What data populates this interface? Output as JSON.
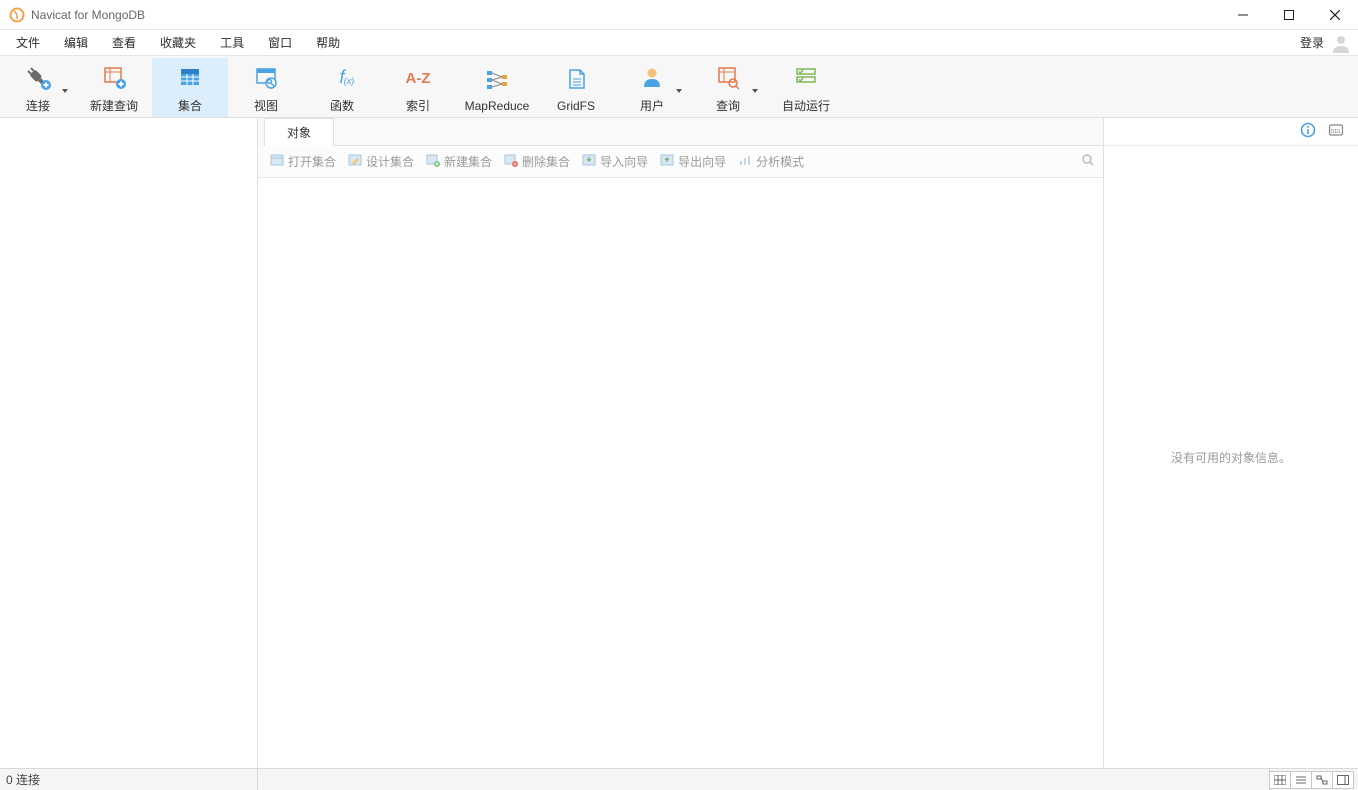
{
  "title": "Navicat for MongoDB",
  "menubar": {
    "items": [
      "文件",
      "编辑",
      "查看",
      "收藏夹",
      "工具",
      "窗口",
      "帮助"
    ],
    "login": "登录"
  },
  "toolbar": {
    "connect": {
      "label": "连接",
      "icon": "plug-icon",
      "has_dropdown": true
    },
    "newquery": {
      "label": "新建查询",
      "icon": "query-icon"
    },
    "collection": {
      "label": "集合",
      "icon": "collection-icon",
      "active": true
    },
    "view": {
      "label": "视图",
      "icon": "view-icon"
    },
    "function": {
      "label": "函数",
      "icon": "function-icon"
    },
    "index": {
      "label": "索引",
      "icon": "index-icon"
    },
    "mapreduce": {
      "label": "MapReduce",
      "icon": "mapreduce-icon"
    },
    "gridfs": {
      "label": "GridFS",
      "icon": "gridfs-icon"
    },
    "user": {
      "label": "用户",
      "icon": "user-icon",
      "has_dropdown": true
    },
    "queries": {
      "label": "查询",
      "icon": "queries-icon",
      "has_dropdown": true
    },
    "autorun": {
      "label": "自动运行",
      "icon": "autorun-icon"
    }
  },
  "objects_tab": "对象",
  "object_toolbar": {
    "open": "打开集合",
    "design": "设计集合",
    "new": "新建集合",
    "delete": "删除集合",
    "import": "导入向导",
    "export": "导出向导",
    "analyze": "分析模式"
  },
  "infopane": {
    "no_info": "没有可用的对象信息。"
  },
  "statusbar": {
    "connections": "0 连接"
  }
}
